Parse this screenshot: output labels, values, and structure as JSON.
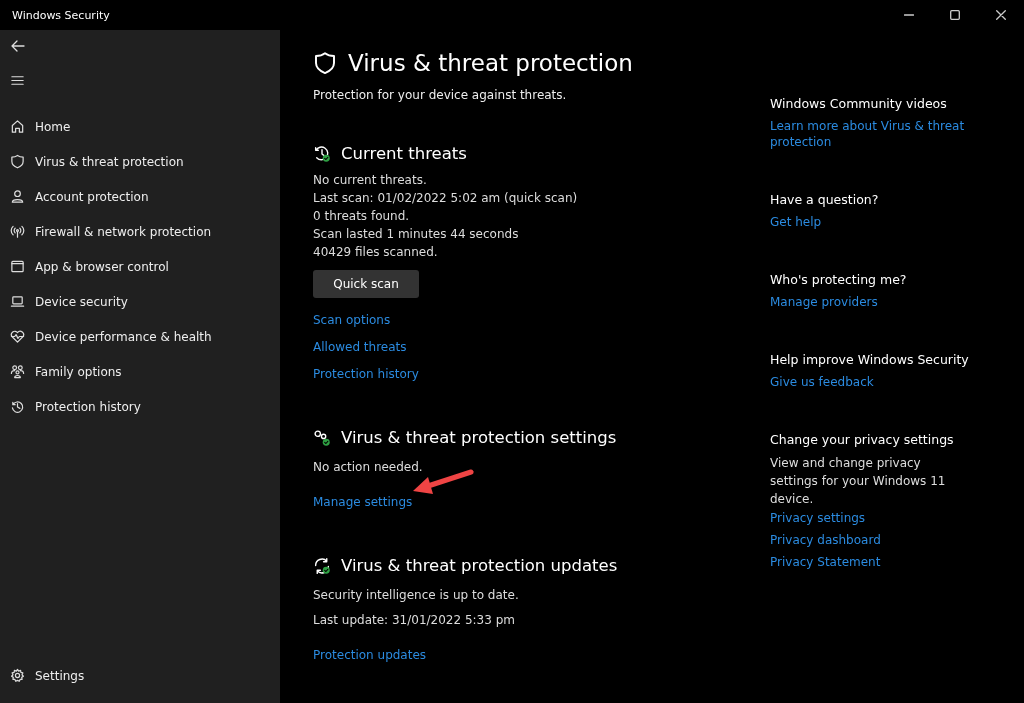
{
  "window": {
    "title": "Windows Security"
  },
  "sidebar": {
    "items": [
      {
        "label": "Home",
        "selected": false
      },
      {
        "label": "Virus & threat protection",
        "selected": false
      },
      {
        "label": "Account protection",
        "selected": false
      },
      {
        "label": "Firewall & network protection",
        "selected": false
      },
      {
        "label": "App & browser control",
        "selected": false
      },
      {
        "label": "Device security",
        "selected": false
      },
      {
        "label": "Device performance & health",
        "selected": false
      },
      {
        "label": "Family options",
        "selected": false
      },
      {
        "label": "Protection history",
        "selected": false
      }
    ],
    "footer_item": {
      "label": "Settings"
    }
  },
  "main": {
    "title": "Virus & threat protection",
    "subtitle": "Protection for your device against threats.",
    "sections": [
      {
        "kind": "threats",
        "heading": "Current threats",
        "lines": [
          "No current threats.",
          "Last scan: 01/02/2022 5:02 am (quick scan)",
          "0 threats found.",
          "Scan lasted 1 minutes 44 seconds",
          "40429 files scanned."
        ],
        "button": "Quick scan",
        "links": [
          "Scan options",
          "Allowed threats",
          "Protection history"
        ]
      },
      {
        "kind": "settings",
        "heading": "Virus & threat protection settings",
        "lines": [
          "No action needed."
        ],
        "links": [
          "Manage settings"
        ]
      },
      {
        "kind": "updates",
        "heading": "Virus & threat protection updates",
        "lines": [
          "Security intelligence is up to date.",
          "Last update: 31/01/2022 5:33 pm"
        ],
        "links": [
          "Protection updates"
        ]
      }
    ]
  },
  "side_panel": [
    {
      "heading": "Windows Community videos",
      "links": [
        "Learn more about Virus & threat protection"
      ]
    },
    {
      "heading": "Have a question?",
      "links": [
        "Get help"
      ]
    },
    {
      "heading": "Who's protecting me?",
      "links": [
        "Manage providers"
      ]
    },
    {
      "heading": "Help improve Windows Security",
      "links": [
        "Give us feedback"
      ]
    },
    {
      "heading": "Change your privacy settings",
      "text": "View and change privacy settings for your Windows 11 device.",
      "links": [
        "Privacy settings",
        "Privacy dashboard",
        "Privacy Statement"
      ]
    }
  ]
}
